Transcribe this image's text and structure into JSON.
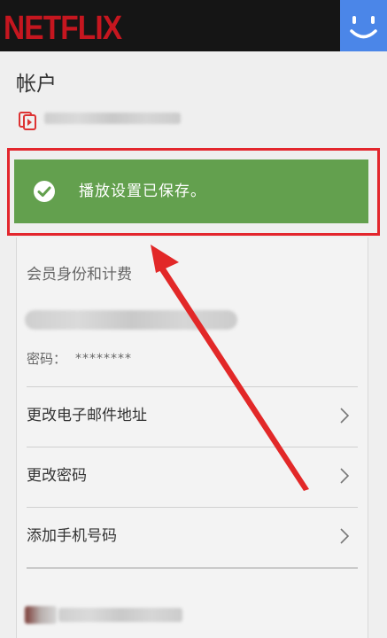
{
  "header": {
    "logo": "NETFLIX"
  },
  "account": {
    "title": "帐户"
  },
  "alert": {
    "message": "播放设置已保存。"
  },
  "membership": {
    "section_title": "会员身份和计费",
    "password_label": "密码：",
    "password_value": "********"
  },
  "rows": [
    {
      "label": "更改电子邮件地址"
    },
    {
      "label": "更改密码"
    },
    {
      "label": "添加手机号码"
    }
  ],
  "colors": {
    "brand_red": "#c5161f",
    "alert_green": "#63a04e",
    "highlight_red": "#e3262d",
    "avatar_blue": "#4b86e8"
  }
}
